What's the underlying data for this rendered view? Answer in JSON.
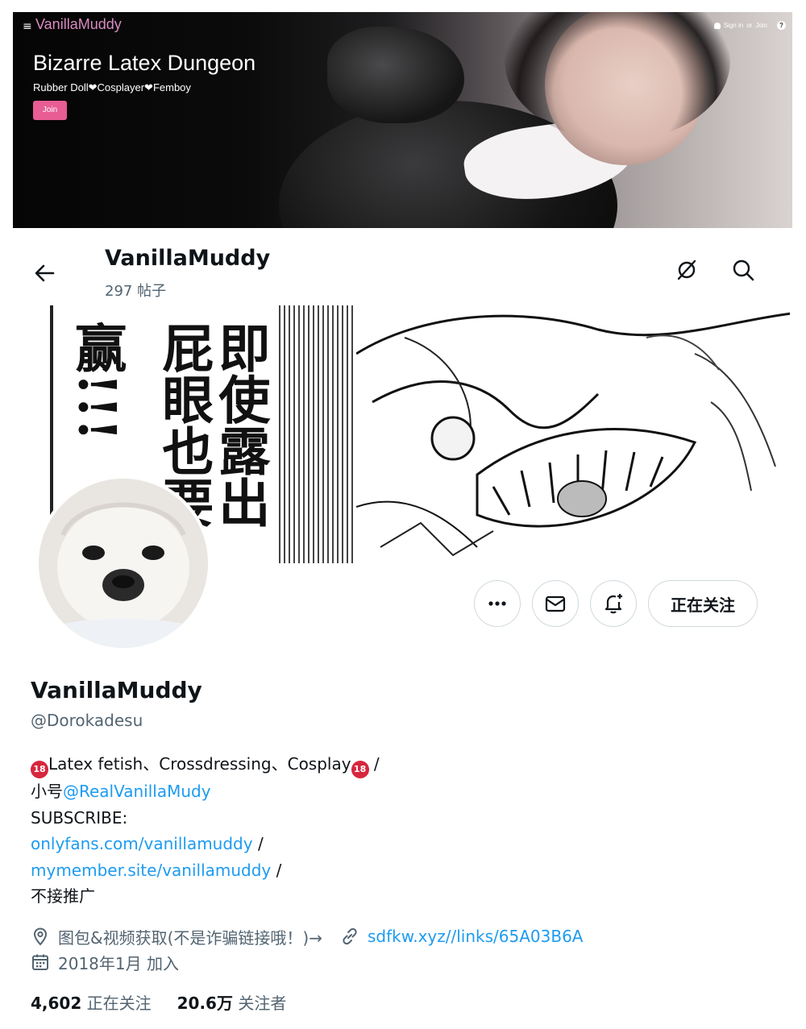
{
  "banner": {
    "menu_icon": "menu-icon",
    "site_name": "VanillaMuddy",
    "title": "Bizarre Latex Dungeon",
    "subtitle": "Rubber Doll❤Cosplayer❤Femboy",
    "join_label": "Join",
    "sign_in_label": "Sign in",
    "or_label": "or",
    "auth_join_label": "Join",
    "accent_color": "#e85d93"
  },
  "header": {
    "title": "VanillaMuddy",
    "post_count": "297 帖子"
  },
  "cover": {
    "col1": "即使露出",
    "col2": "屁眼也要",
    "col3": "赢!!!"
  },
  "actions": {
    "more_icon": "more-icon",
    "message_icon": "envelope-icon",
    "notify_icon": "bell-plus-icon",
    "follow_label": "正在关注"
  },
  "profile": {
    "display_name": "VanillaMuddy",
    "handle": "@Dorokadesu",
    "bio": {
      "line1_badge": "18",
      "line1_text": "Latex fetish、Crossdressing、Cosplay",
      "line1_badge2": "18",
      "line1_suffix": " /",
      "line2_prefix": "小号",
      "line2_link": "@RealVanillaMudy",
      "line3": "SUBSCRIBE:",
      "line4_link": "onlyfans.com/vanillamuddy",
      "line4_suffix": " /",
      "line5_link": "mymember.site/vanillamuddy",
      "line5_suffix": " /",
      "line6": "不接推广"
    },
    "location": "图包&视频获取(不是诈骗链接哦！)→",
    "website": "sdfkw.xyz//links/65A03B6A",
    "joined": "2018年1月 加入",
    "following_count": "4,602",
    "following_label": "正在关注",
    "followers_count": "20.6万",
    "followers_label": "关注者"
  },
  "colors": {
    "link": "#1d9bf0",
    "secondary_text": "#536471",
    "border": "#cfd9de"
  }
}
